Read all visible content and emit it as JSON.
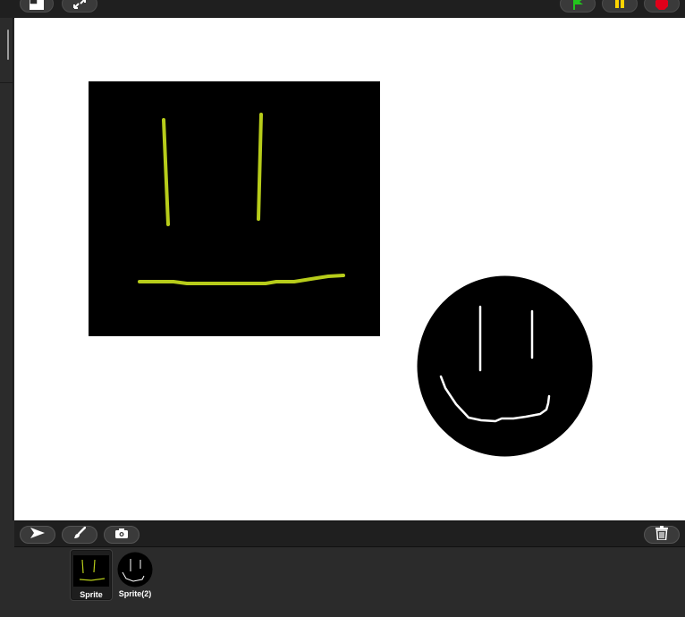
{
  "toolbar": {
    "buttons": [
      {
        "id": "stage-size-toggle",
        "icon": "stage-size-icon"
      },
      {
        "id": "fullscreen",
        "icon": "fullscreen-icon"
      },
      {
        "id": "green-flag",
        "icon": "green-flag-icon",
        "color": "#22c51d"
      },
      {
        "id": "pause",
        "icon": "pause-icon",
        "color": "#ffd400"
      },
      {
        "id": "stop",
        "icon": "stop-icon",
        "color": "#e0001a"
      }
    ]
  },
  "stage": {
    "background": "#ffffff",
    "sprites": [
      {
        "name": "Sprite",
        "costume": "black-square-smiley",
        "line_color": "#b7cc1a"
      },
      {
        "name": "Sprite(2)",
        "costume": "black-circle-smiley",
        "line_color": "#ffffff"
      }
    ]
  },
  "corral": {
    "tools": [
      {
        "id": "turtle",
        "icon": "turtle-arrow-icon"
      },
      {
        "id": "paint",
        "icon": "paintbrush-icon"
      },
      {
        "id": "camera",
        "icon": "camera-icon"
      }
    ],
    "trash_icon": "trash-icon",
    "sprites": [
      {
        "label": "Sprite",
        "selected": true
      },
      {
        "label": "Sprite(2)",
        "selected": false
      }
    ]
  }
}
